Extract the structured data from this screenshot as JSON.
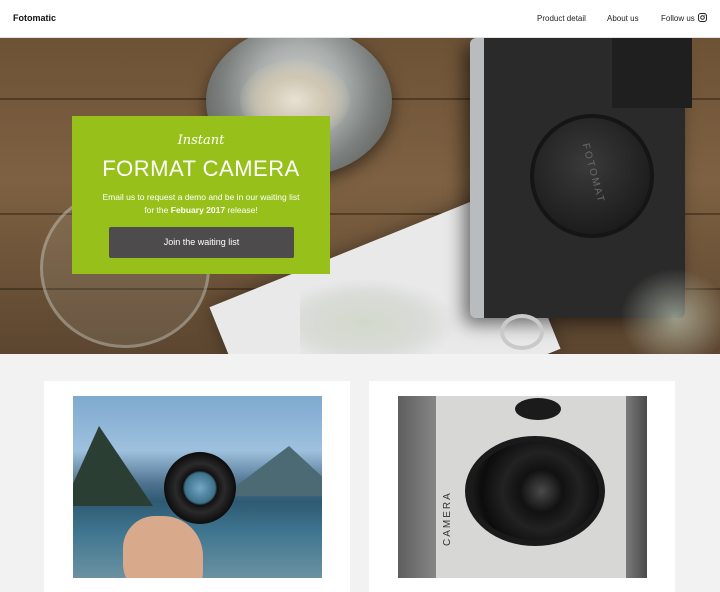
{
  "header": {
    "brand": "Fotomatic",
    "nav": [
      {
        "label": "Product detail"
      },
      {
        "label": "About us"
      },
      {
        "label": "Follow us"
      }
    ],
    "social_icon": "instagram-icon"
  },
  "hero": {
    "camera_cap_text": "FOTOMAT",
    "promo": {
      "script_label": "Instant",
      "title": "FORMAT CAMERA",
      "text_before": "Email us to request a demo and be in our waiting list for the ",
      "text_highlight": "Febuary 2017",
      "text_after": " release!",
      "button_label": "Join the waiting list"
    }
  },
  "cards": [
    {
      "image": "hand holding a camera lens over a lake with mountains"
    },
    {
      "image": "close-up of a vintage instant camera lens",
      "camera_text": "CAMERA"
    }
  ],
  "colors": {
    "accent": "#97c11a",
    "button": "#4d4b4c",
    "background": "#f2f2f2"
  }
}
